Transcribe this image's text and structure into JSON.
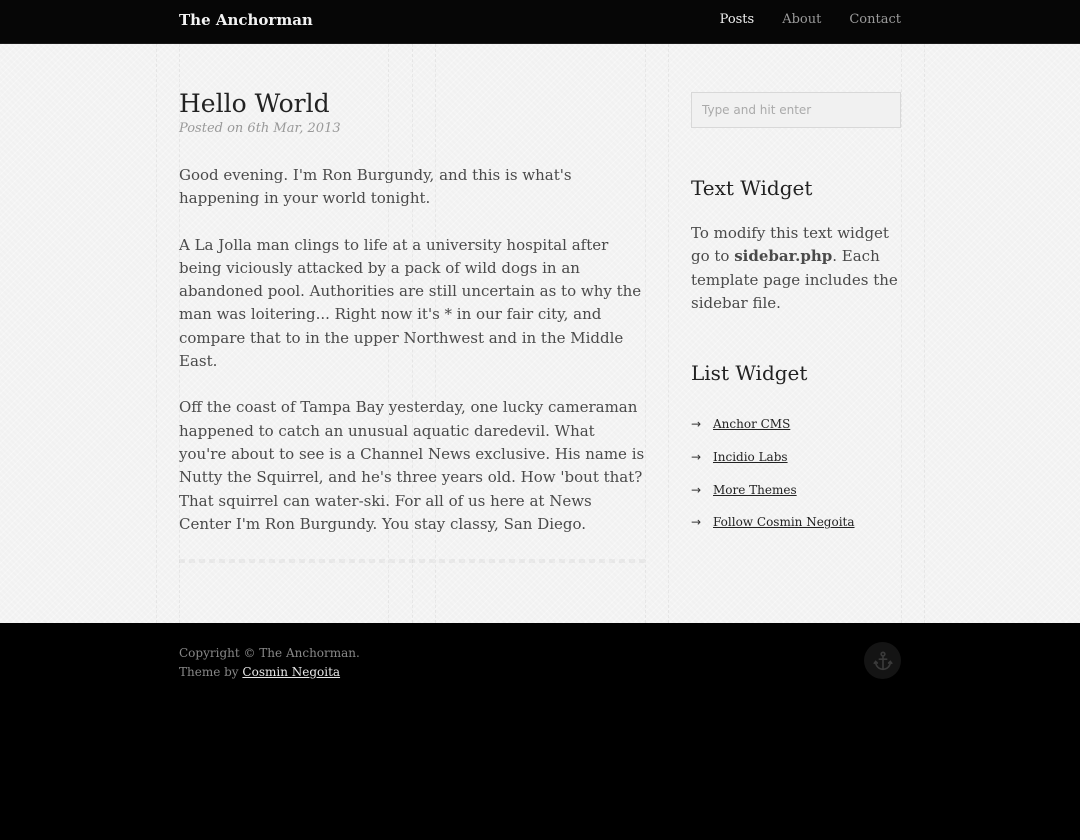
{
  "site": {
    "title": "The Anchorman"
  },
  "nav": {
    "items": [
      {
        "label": "Posts",
        "active": true
      },
      {
        "label": "About",
        "active": false
      },
      {
        "label": "Contact",
        "active": false
      }
    ]
  },
  "post": {
    "title": "Hello World",
    "meta": "Posted on 6th Mar, 2013",
    "paragraphs": [
      "Good evening. I'm Ron Burgundy, and this is what's happening in your world tonight.",
      "A La Jolla man clings to life at a university hospital after being viciously attacked by a pack of wild dogs in an abandoned pool. Authorities are still uncertain as to why the man was loitering... Right now it's * in our fair city, and compare that to in the upper Northwest and in the Middle East.",
      "Off the coast of Tampa Bay yesterday, one lucky cameraman happened to catch an unusual aquatic daredevil. What you're about to see is a Channel News exclusive. His name is Nutty the Squirrel, and he's three years old. How 'bout that? That squirrel can water-ski. For all of us here at News Center I'm Ron Burgundy. You stay classy, San Diego."
    ]
  },
  "sidebar": {
    "search_placeholder": "Type and hit enter",
    "text_widget": {
      "title": "Text Widget",
      "text_before": "To modify this text widget go to ",
      "text_bold": "sidebar.php",
      "text_after": ". Each template page includes the sidebar file."
    },
    "list_widget": {
      "title": "List Widget",
      "arrow": "→",
      "items": [
        "Anchor CMS",
        "Incidio Labs",
        "More Themes",
        "Follow Cosmin Negoita"
      ]
    }
  },
  "footer": {
    "copyright": "Copyright © The Anchorman.",
    "theme_prefix": "Theme by ",
    "theme_author": "Cosmin Negoita",
    "back_to_top_icon": "anchor-icon"
  },
  "colors": {
    "topbar": "#060606",
    "page_bg": "#f4f4f4",
    "footer_bg": "#000000",
    "text": "#4a4a4a",
    "heading": "#222222"
  }
}
